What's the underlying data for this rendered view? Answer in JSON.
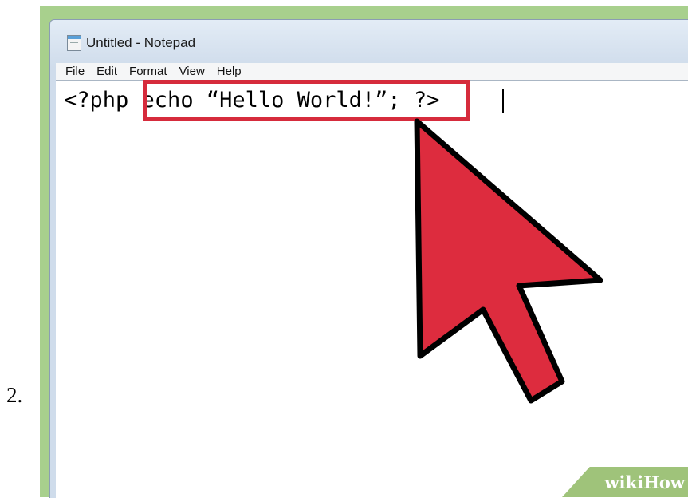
{
  "step": {
    "number": "2."
  },
  "window": {
    "title": "Untitled - Notepad",
    "icon": "notepad-icon"
  },
  "menu": [
    "File",
    "Edit",
    "Format",
    "View",
    "Help"
  ],
  "editor": {
    "text_before": "<?php ",
    "text_highlighted": "echo “Hello World!”;",
    "text_after": " ?>"
  },
  "annotation": {
    "box_color": "#d62b3c",
    "arrow_color": "#dd2c3e",
    "arrow_outline": "#000000"
  },
  "watermark": {
    "text": "wikiHow"
  },
  "colors": {
    "frame": "#a8d08d",
    "window_chrome": "#cfdceb"
  }
}
